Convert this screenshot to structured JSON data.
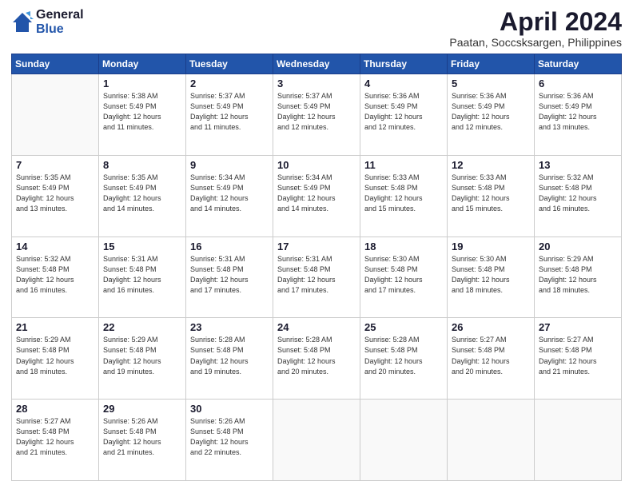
{
  "logo": {
    "general": "General",
    "blue": "Blue"
  },
  "header": {
    "month_title": "April 2024",
    "subtitle": "Paatan, Soccsksargen, Philippines"
  },
  "days_of_week": [
    "Sunday",
    "Monday",
    "Tuesday",
    "Wednesday",
    "Thursday",
    "Friday",
    "Saturday"
  ],
  "weeks": [
    [
      {
        "day": "",
        "info": ""
      },
      {
        "day": "1",
        "info": "Sunrise: 5:38 AM\nSunset: 5:49 PM\nDaylight: 12 hours\nand 11 minutes."
      },
      {
        "day": "2",
        "info": "Sunrise: 5:37 AM\nSunset: 5:49 PM\nDaylight: 12 hours\nand 11 minutes."
      },
      {
        "day": "3",
        "info": "Sunrise: 5:37 AM\nSunset: 5:49 PM\nDaylight: 12 hours\nand 12 minutes."
      },
      {
        "day": "4",
        "info": "Sunrise: 5:36 AM\nSunset: 5:49 PM\nDaylight: 12 hours\nand 12 minutes."
      },
      {
        "day": "5",
        "info": "Sunrise: 5:36 AM\nSunset: 5:49 PM\nDaylight: 12 hours\nand 12 minutes."
      },
      {
        "day": "6",
        "info": "Sunrise: 5:36 AM\nSunset: 5:49 PM\nDaylight: 12 hours\nand 13 minutes."
      }
    ],
    [
      {
        "day": "7",
        "info": "Sunrise: 5:35 AM\nSunset: 5:49 PM\nDaylight: 12 hours\nand 13 minutes."
      },
      {
        "day": "8",
        "info": "Sunrise: 5:35 AM\nSunset: 5:49 PM\nDaylight: 12 hours\nand 14 minutes."
      },
      {
        "day": "9",
        "info": "Sunrise: 5:34 AM\nSunset: 5:49 PM\nDaylight: 12 hours\nand 14 minutes."
      },
      {
        "day": "10",
        "info": "Sunrise: 5:34 AM\nSunset: 5:49 PM\nDaylight: 12 hours\nand 14 minutes."
      },
      {
        "day": "11",
        "info": "Sunrise: 5:33 AM\nSunset: 5:48 PM\nDaylight: 12 hours\nand 15 minutes."
      },
      {
        "day": "12",
        "info": "Sunrise: 5:33 AM\nSunset: 5:48 PM\nDaylight: 12 hours\nand 15 minutes."
      },
      {
        "day": "13",
        "info": "Sunrise: 5:32 AM\nSunset: 5:48 PM\nDaylight: 12 hours\nand 16 minutes."
      }
    ],
    [
      {
        "day": "14",
        "info": "Sunrise: 5:32 AM\nSunset: 5:48 PM\nDaylight: 12 hours\nand 16 minutes."
      },
      {
        "day": "15",
        "info": "Sunrise: 5:31 AM\nSunset: 5:48 PM\nDaylight: 12 hours\nand 16 minutes."
      },
      {
        "day": "16",
        "info": "Sunrise: 5:31 AM\nSunset: 5:48 PM\nDaylight: 12 hours\nand 17 minutes."
      },
      {
        "day": "17",
        "info": "Sunrise: 5:31 AM\nSunset: 5:48 PM\nDaylight: 12 hours\nand 17 minutes."
      },
      {
        "day": "18",
        "info": "Sunrise: 5:30 AM\nSunset: 5:48 PM\nDaylight: 12 hours\nand 17 minutes."
      },
      {
        "day": "19",
        "info": "Sunrise: 5:30 AM\nSunset: 5:48 PM\nDaylight: 12 hours\nand 18 minutes."
      },
      {
        "day": "20",
        "info": "Sunrise: 5:29 AM\nSunset: 5:48 PM\nDaylight: 12 hours\nand 18 minutes."
      }
    ],
    [
      {
        "day": "21",
        "info": "Sunrise: 5:29 AM\nSunset: 5:48 PM\nDaylight: 12 hours\nand 18 minutes."
      },
      {
        "day": "22",
        "info": "Sunrise: 5:29 AM\nSunset: 5:48 PM\nDaylight: 12 hours\nand 19 minutes."
      },
      {
        "day": "23",
        "info": "Sunrise: 5:28 AM\nSunset: 5:48 PM\nDaylight: 12 hours\nand 19 minutes."
      },
      {
        "day": "24",
        "info": "Sunrise: 5:28 AM\nSunset: 5:48 PM\nDaylight: 12 hours\nand 20 minutes."
      },
      {
        "day": "25",
        "info": "Sunrise: 5:28 AM\nSunset: 5:48 PM\nDaylight: 12 hours\nand 20 minutes."
      },
      {
        "day": "26",
        "info": "Sunrise: 5:27 AM\nSunset: 5:48 PM\nDaylight: 12 hours\nand 20 minutes."
      },
      {
        "day": "27",
        "info": "Sunrise: 5:27 AM\nSunset: 5:48 PM\nDaylight: 12 hours\nand 21 minutes."
      }
    ],
    [
      {
        "day": "28",
        "info": "Sunrise: 5:27 AM\nSunset: 5:48 PM\nDaylight: 12 hours\nand 21 minutes."
      },
      {
        "day": "29",
        "info": "Sunrise: 5:26 AM\nSunset: 5:48 PM\nDaylight: 12 hours\nand 21 minutes."
      },
      {
        "day": "30",
        "info": "Sunrise: 5:26 AM\nSunset: 5:48 PM\nDaylight: 12 hours\nand 22 minutes."
      },
      {
        "day": "",
        "info": ""
      },
      {
        "day": "",
        "info": ""
      },
      {
        "day": "",
        "info": ""
      },
      {
        "day": "",
        "info": ""
      }
    ]
  ]
}
